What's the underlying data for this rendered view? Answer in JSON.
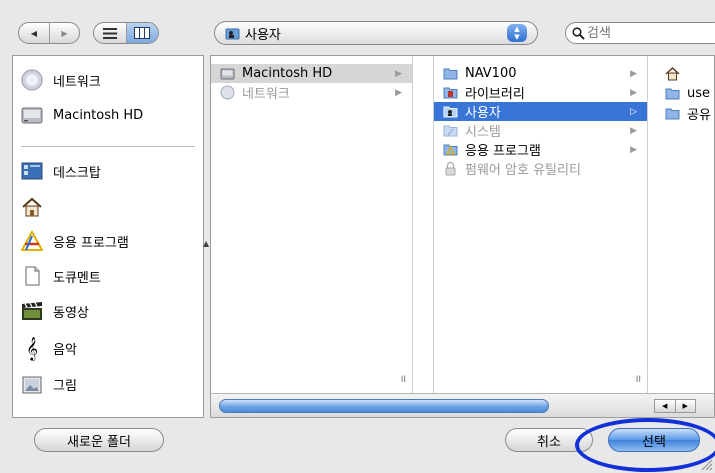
{
  "toolbar": {
    "location": "사용자",
    "search_placeholder": "검색"
  },
  "sidebar": {
    "items": [
      {
        "label": "네트워크",
        "icon": "network-icon"
      },
      {
        "label": "Macintosh HD",
        "icon": "hard-disk-icon"
      },
      {
        "label": "데스크탑",
        "icon": "desktop-icon"
      },
      {
        "label": "",
        "icon": "home-icon"
      },
      {
        "label": "응용 프로그램",
        "icon": "applications-icon"
      },
      {
        "label": "도큐멘트",
        "icon": "documents-icon"
      },
      {
        "label": "동영상",
        "icon": "movies-icon"
      },
      {
        "label": "음악",
        "icon": "music-icon"
      },
      {
        "label": "그림",
        "icon": "pictures-icon"
      }
    ]
  },
  "columns": {
    "col1": [
      {
        "label": "Macintosh HD",
        "icon": "hard-disk-icon",
        "state": "highlighted",
        "has_children": true
      },
      {
        "label": "네트워크",
        "icon": "network-icon",
        "state": "dimmed",
        "has_children": true
      }
    ],
    "col2": [
      {
        "label": "NAV100",
        "icon": "folder-icon",
        "state": "normal",
        "has_children": true
      },
      {
        "label": "라이브러리",
        "icon": "library-folder-icon",
        "state": "normal",
        "has_children": true
      },
      {
        "label": "사용자",
        "icon": "users-folder-icon",
        "state": "selected",
        "has_children": true
      },
      {
        "label": "시스템",
        "icon": "system-folder-icon",
        "state": "dimmed",
        "has_children": true
      },
      {
        "label": "응용 프로그램",
        "icon": "applications-folder-icon",
        "state": "normal",
        "has_children": true
      },
      {
        "label": "펌웨어 암호 유틸리티",
        "icon": "lock-icon",
        "state": "dimmed",
        "has_children": false
      }
    ],
    "col3": [
      {
        "label": "",
        "icon": "home-icon",
        "state": "normal"
      },
      {
        "label": "use",
        "icon": "folder-icon",
        "state": "normal"
      },
      {
        "label": "공유",
        "icon": "folder-icon",
        "state": "normal"
      }
    ]
  },
  "buttons": {
    "new_folder": "새로운 폴더",
    "cancel": "취소",
    "choose": "선택"
  },
  "colors": {
    "selection": "#3875d7",
    "annotation": "#1130d8"
  }
}
